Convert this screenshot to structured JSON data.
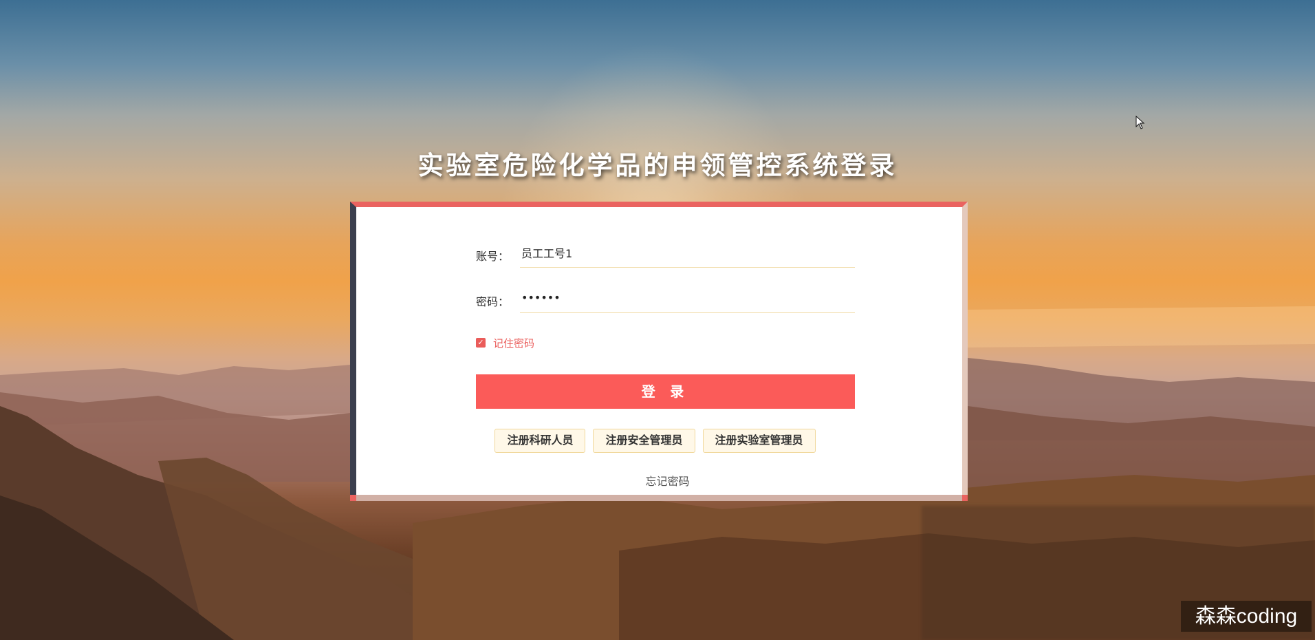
{
  "page": {
    "title": "实验室危险化学品的申领管控系统登录"
  },
  "login_form": {
    "account_label": "账号：",
    "account_value": "员工工号1",
    "password_label": "密码：",
    "password_value": "123456",
    "remember_label": "记住密码",
    "remember_checked": true,
    "login_button": "登 录",
    "register_buttons": [
      "注册科研人员",
      "注册安全管理员",
      "注册实验室管理员"
    ],
    "forgot_password": "忘记密码"
  },
  "watermark": {
    "text": "森森coding"
  },
  "colors": {
    "accent": "#fb5b59",
    "card_top_border": "#ea6360",
    "card_left_border": "#3b3f4e",
    "register_button_bg": "#fff8e8",
    "register_button_border": "#f0d79a"
  },
  "icons": {
    "checkbox": "check-icon",
    "cursor": "mouse-pointer-icon"
  }
}
